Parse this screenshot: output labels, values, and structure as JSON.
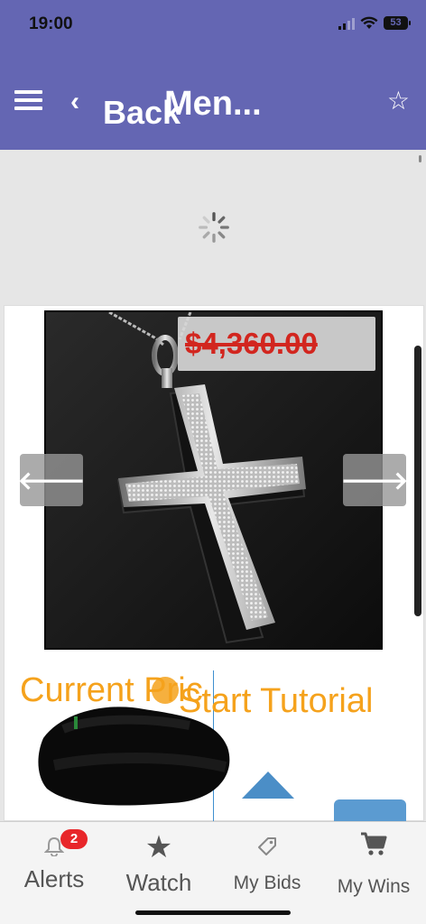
{
  "status_bar": {
    "time": "19:00",
    "battery": "53"
  },
  "header": {
    "back_label": "Back",
    "title": "Men...",
    "icons": [
      "menu-icon",
      "chevron-left-icon",
      "star-outline-icon"
    ]
  },
  "product": {
    "old_price": "$4,360.00",
    "prev_glyph": "🡐",
    "next_glyph": "🡒"
  },
  "bidding": {
    "current_price_label": "Current Pric",
    "tutorial_label": "Start Tutorial"
  },
  "tabbar": {
    "items": [
      {
        "label": "Alerts",
        "icon": "bell-icon",
        "badge": "2"
      },
      {
        "label": "Watch",
        "icon": "star-icon"
      },
      {
        "label": "My Bids",
        "icon": "tag-icon"
      },
      {
        "label": "My Wins",
        "icon": "cart-icon"
      }
    ]
  },
  "colors": {
    "header": "#6466b3",
    "accent": "#f5a21c",
    "price": "#d2261f",
    "badge": "#e8262a"
  }
}
